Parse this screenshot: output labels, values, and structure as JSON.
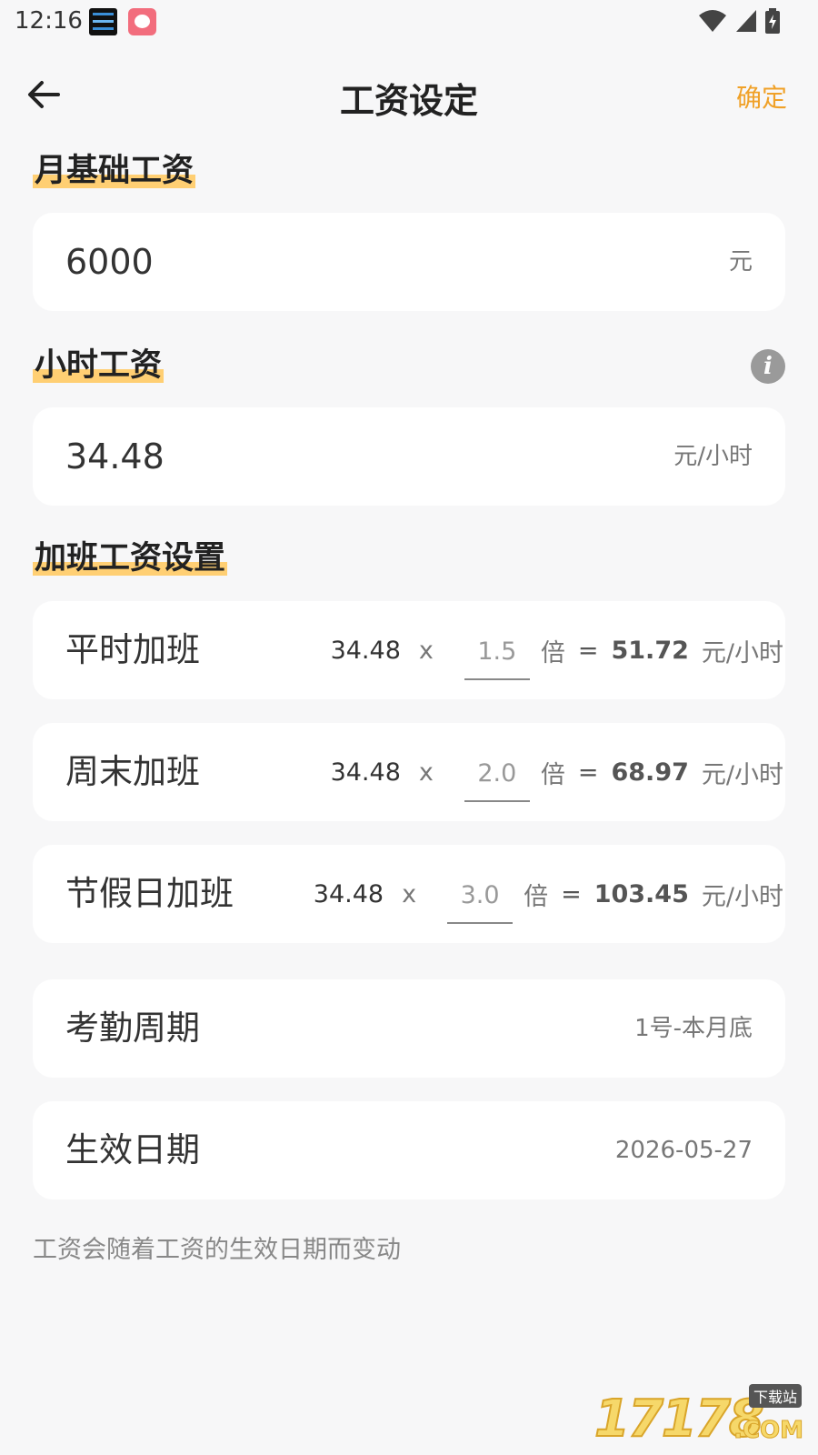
{
  "status_bar": {
    "time": "12:16",
    "icons": [
      "wifi-icon",
      "signal-icon",
      "battery-charging-icon"
    ]
  },
  "header": {
    "title": "工资设定",
    "confirm_label": "确定",
    "back_icon": "arrow-left-icon"
  },
  "monthly": {
    "section_title": "月基础工资",
    "value": "6000",
    "unit": "元"
  },
  "hourly": {
    "section_title": "小时工资",
    "info_icon": "info-icon",
    "value": "34.48",
    "unit": "元/小时"
  },
  "overtime": {
    "section_title": "加班工资设置",
    "rows": [
      {
        "label": "平时加班",
        "base": "34.48",
        "times": "x",
        "multiplier": "1.5",
        "bei": "倍",
        "eq": "=",
        "result": "51.72",
        "unit": "元/小时"
      },
      {
        "label": "周末加班",
        "base": "34.48",
        "times": "x",
        "multiplier": "2.0",
        "bei": "倍",
        "eq": "=",
        "result": "68.97",
        "unit": "元/小时"
      },
      {
        "label": "节假日加班",
        "base": "34.48",
        "times": "x",
        "multiplier": "3.0",
        "bei": "倍",
        "eq": "=",
        "result": "103.45",
        "unit": "元/小时"
      }
    ]
  },
  "attendance": {
    "label": "考勤周期",
    "value": "1号-本月底"
  },
  "effective_date": {
    "label": "生效日期",
    "value": "2026-05-27"
  },
  "footer_note": "工资会随着工资的生效日期而变动",
  "watermark": {
    "number": "17178",
    "tag": "下载站",
    "suffix": ".COM"
  },
  "colors": {
    "accent": "#f0a128",
    "highlight": "#ffcf73",
    "card": "#ffffff",
    "background": "#f7f7f8"
  }
}
